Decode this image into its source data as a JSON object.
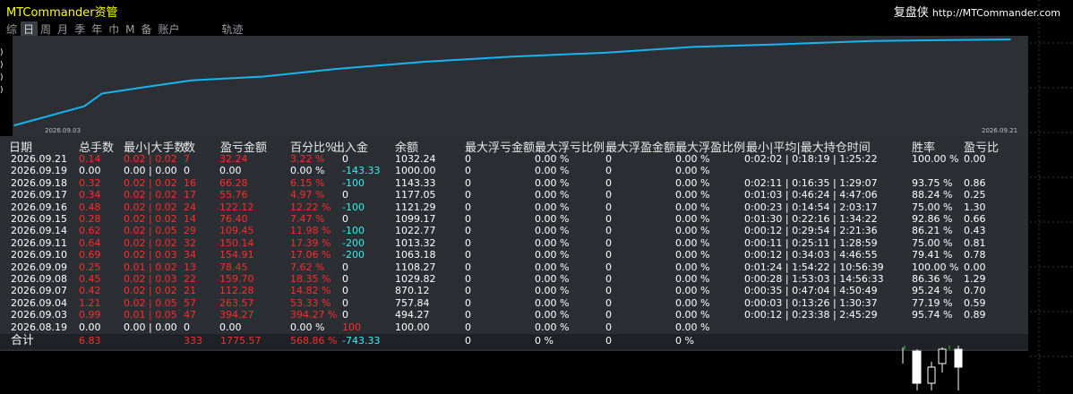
{
  "app": {
    "title": "MTCommander资管",
    "brand_right": "复盘侠",
    "url": "http://MTCommander.com"
  },
  "period_tabs": [
    {
      "label": "综",
      "active": false
    },
    {
      "label": "日",
      "active": true
    },
    {
      "label": "周",
      "active": false
    },
    {
      "label": "月",
      "active": false
    },
    {
      "label": "季",
      "active": false
    },
    {
      "label": "年",
      "active": false
    },
    {
      "label": "巾",
      "active": false
    },
    {
      "label": "M",
      "active": false
    },
    {
      "label": "备",
      "active": false
    },
    {
      "label": "账户",
      "active": false
    },
    {
      "label": "轨迹",
      "active": false
    }
  ],
  "colors": {
    "accent_yellow": "#ffff00",
    "curve": "#18b4f0",
    "loss": "#ff2b2b",
    "flow": "#33f0f0"
  },
  "chart_data": {
    "type": "line",
    "x_labels": [
      "2026.09.03",
      "2026.09.21"
    ],
    "x": [
      "2026.09.03",
      "2026.09.04",
      "2026.09.07",
      "2026.09.08",
      "2026.09.09",
      "2026.09.10",
      "2026.09.11",
      "2026.09.14",
      "2026.09.15",
      "2026.09.16",
      "2026.09.17",
      "2026.09.18",
      "2026.09.19",
      "2026.09.21"
    ],
    "values": [
      100,
      494.27,
      757.84,
      870.12,
      1029.82,
      1108.27,
      1063.18,
      1013.32,
      1022.77,
      1099.17,
      1121.29,
      1177.05,
      1143.33,
      1000.0
    ],
    "cumulative_profit": [
      0,
      394.27,
      657.84,
      770.12,
      929.82,
      1008.27,
      1163.18,
      1313.32,
      1422.77,
      1499.17,
      1621.29,
      1677.05,
      1743.33,
      1775.57
    ],
    "grid": false
  },
  "table": {
    "headers": [
      "日期",
      "总手数",
      "最小|大手数",
      "数",
      "盈亏金额",
      "百分比%",
      "出入金",
      "余额",
      "最大浮亏金额",
      "最大浮亏比例",
      "最大浮盈金额",
      "最大浮盈比例",
      "最小|平均|最大持仓时间",
      "胜率",
      "盈亏比"
    ],
    "rows": [
      {
        "date": "2026.09.21",
        "lots": "0.14",
        "minmax": "0.02 | 0.02",
        "count": "7",
        "pnl": "32.24",
        "pct": "3.22 %",
        "flow": "0",
        "balance": "1032.24",
        "maxdd": "0",
        "maxdd_pct": "0.00 %",
        "maxfp": "0",
        "maxfp_pct": "0.00 %",
        "hold": "0:02:02 | 0:18:19 | 1:25:22",
        "win": "100.00 %",
        "pf": "0.00"
      },
      {
        "date": "2026.09.19",
        "lots": "0.00",
        "minmax": "0.00 | 0.00",
        "count": "0",
        "pnl": "0.00",
        "pct": "0.00 %",
        "flow": "-143.33",
        "balance": "1000.00",
        "maxdd": "0",
        "maxdd_pct": "0.00 %",
        "maxfp": "0",
        "maxfp_pct": "0.00 %",
        "hold": "",
        "win": "",
        "pf": ""
      },
      {
        "date": "2026.09.18",
        "lots": "0.32",
        "minmax": "0.02 | 0.02",
        "count": "16",
        "pnl": "66.28",
        "pct": "6.15 %",
        "flow": "-100",
        "balance": "1143.33",
        "maxdd": "0",
        "maxdd_pct": "0.00 %",
        "maxfp": "0",
        "maxfp_pct": "0.00 %",
        "hold": "0:02:11 | 0:16:35 | 1:29:07",
        "win": "93.75 %",
        "pf": "0.86"
      },
      {
        "date": "2026.09.17",
        "lots": "0.34",
        "minmax": "0.02 | 0.02",
        "count": "17",
        "pnl": "55.76",
        "pct": "4.97 %",
        "flow": "0",
        "balance": "1177.05",
        "maxdd": "0",
        "maxdd_pct": "0.00 %",
        "maxfp": "0",
        "maxfp_pct": "0.00 %",
        "hold": "0:01:03 | 0:46:24 | 4:47:06",
        "win": "88.24 %",
        "pf": "0.25"
      },
      {
        "date": "2026.09.16",
        "lots": "0.48",
        "minmax": "0.02 | 0.02",
        "count": "24",
        "pnl": "122.12",
        "pct": "12.22 %",
        "flow": "-100",
        "balance": "1121.29",
        "maxdd": "0",
        "maxdd_pct": "0.00 %",
        "maxfp": "0",
        "maxfp_pct": "0.00 %",
        "hold": "0:00:23 | 0:14:54 | 2:03:17",
        "win": "75.00 %",
        "pf": "1.30"
      },
      {
        "date": "2026.09.15",
        "lots": "0.28",
        "minmax": "0.02 | 0.02",
        "count": "14",
        "pnl": "76.40",
        "pct": "7.47 %",
        "flow": "0",
        "balance": "1099.17",
        "maxdd": "0",
        "maxdd_pct": "0.00 %",
        "maxfp": "0",
        "maxfp_pct": "0.00 %",
        "hold": "0:01:30 | 0:22:16 | 1:34:22",
        "win": "92.86 %",
        "pf": "0.66"
      },
      {
        "date": "2026.09.14",
        "lots": "0.62",
        "minmax": "0.02 | 0.05",
        "count": "29",
        "pnl": "109.45",
        "pct": "11.98 %",
        "flow": "-100",
        "balance": "1022.77",
        "maxdd": "0",
        "maxdd_pct": "0.00 %",
        "maxfp": "0",
        "maxfp_pct": "0.00 %",
        "hold": "0:00:12 | 0:29:54 | 2:21:36",
        "win": "86.21 %",
        "pf": "0.43"
      },
      {
        "date": "2026.09.11",
        "lots": "0.64",
        "minmax": "0.02 | 0.02",
        "count": "32",
        "pnl": "150.14",
        "pct": "17.39 %",
        "flow": "-200",
        "balance": "1013.32",
        "maxdd": "0",
        "maxdd_pct": "0.00 %",
        "maxfp": "0",
        "maxfp_pct": "0.00 %",
        "hold": "0:00:11 | 0:25:11 | 1:28:59",
        "win": "75.00 %",
        "pf": "0.81"
      },
      {
        "date": "2026.09.10",
        "lots": "0.69",
        "minmax": "0.02 | 0.03",
        "count": "34",
        "pnl": "154.91",
        "pct": "17.06 %",
        "flow": "-200",
        "balance": "1063.18",
        "maxdd": "0",
        "maxdd_pct": "0.00 %",
        "maxfp": "0",
        "maxfp_pct": "0.00 %",
        "hold": "0:00:12 | 0:34:03 | 4:46:55",
        "win": "79.41 %",
        "pf": "0.78"
      },
      {
        "date": "2026.09.09",
        "lots": "0.25",
        "minmax": "0.01 | 0.02",
        "count": "13",
        "pnl": "78.45",
        "pct": "7.62 %",
        "flow": "0",
        "balance": "1108.27",
        "maxdd": "0",
        "maxdd_pct": "0.00 %",
        "maxfp": "0",
        "maxfp_pct": "0.00 %",
        "hold": "0:01:24 | 1:54:22 | 10:56:39",
        "win": "100.00 %",
        "pf": "0.00"
      },
      {
        "date": "2026.09.08",
        "lots": "0.45",
        "minmax": "0.02 | 0.03",
        "count": "22",
        "pnl": "159.70",
        "pct": "18.35 %",
        "flow": "0",
        "balance": "1029.82",
        "maxdd": "0",
        "maxdd_pct": "0.00 %",
        "maxfp": "0",
        "maxfp_pct": "0.00 %",
        "hold": "0:00:28 | 1:53:03 | 14:56:33",
        "win": "86.36 %",
        "pf": "1.29"
      },
      {
        "date": "2026.09.07",
        "lots": "0.42",
        "minmax": "0.02 | 0.02",
        "count": "21",
        "pnl": "112.28",
        "pct": "14.82 %",
        "flow": "0",
        "balance": "870.12",
        "maxdd": "0",
        "maxdd_pct": "0.00 %",
        "maxfp": "0",
        "maxfp_pct": "0.00 %",
        "hold": "0:00:35 | 0:47:04 | 4:50:49",
        "win": "95.24 %",
        "pf": "0.70"
      },
      {
        "date": "2026.09.04",
        "lots": "1.21",
        "minmax": "0.02 | 0.05",
        "count": "57",
        "pnl": "263.57",
        "pct": "53.33 %",
        "flow": "0",
        "balance": "757.84",
        "maxdd": "0",
        "maxdd_pct": "0.00 %",
        "maxfp": "0",
        "maxfp_pct": "0.00 %",
        "hold": "0:00:03 | 0:13:26 | 1:30:37",
        "win": "77.19 %",
        "pf": "0.59"
      },
      {
        "date": "2026.09.03",
        "lots": "0.99",
        "minmax": "0.01 | 0.05",
        "count": "47",
        "pnl": "394.27",
        "pct": "394.27 %",
        "flow": "0",
        "balance": "494.27",
        "maxdd": "0",
        "maxdd_pct": "0.00 %",
        "maxfp": "0",
        "maxfp_pct": "0.00 %",
        "hold": "0:00:12 | 0:23:38 | 2:45:29",
        "win": "95.74 %",
        "pf": "0.89"
      },
      {
        "date": "2026.08.19",
        "lots": "0.00",
        "minmax": "0.00 | 0.00",
        "count": "0",
        "pnl": "0.00",
        "pct": "0.00 %",
        "flow": "100",
        "balance": "100.00",
        "maxdd": "0",
        "maxdd_pct": "0.00 %",
        "maxfp": "0",
        "maxfp_pct": "0.00 %",
        "hold": "",
        "win": "",
        "pf": ""
      }
    ],
    "total": {
      "label": "合计",
      "lots": "6.83",
      "count": "333",
      "pnl": "1775.57",
      "pct": "568.86 %",
      "flow": "-743.33",
      "maxdd": "0",
      "maxdd_pct": "0 %",
      "maxfp": "0",
      "maxfp_pct": "0 %"
    }
  }
}
